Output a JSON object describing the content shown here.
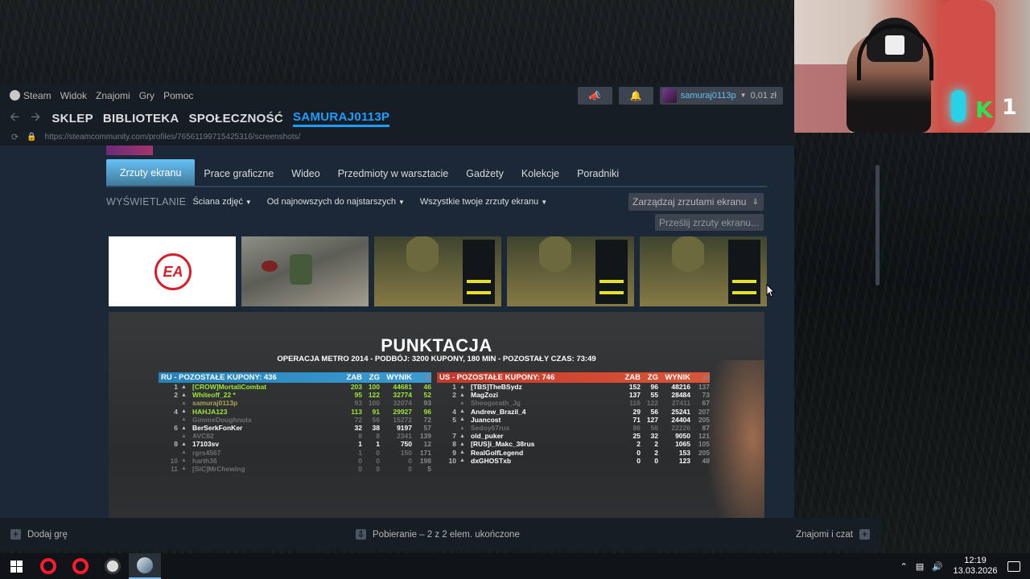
{
  "menubar": {
    "items": [
      "Steam",
      "Widok",
      "Znajomi",
      "Gry",
      "Pomoc"
    ],
    "username": "samuraj0113p",
    "balance": "0,01 zł",
    "megaphone_icon": "megaphone-icon",
    "bell_icon": "bell-icon"
  },
  "nav": {
    "links": [
      "SKLEP",
      "BIBLIOTEKA",
      "SPOŁECZNOŚĆ",
      "SAMURAJ0113P"
    ],
    "url": "https://steamcommunity.com/profiles/76561199715425316/screenshots/"
  },
  "tabs": [
    "Zrzuty ekranu",
    "Prace graficzne",
    "Wideo",
    "Przedmioty w warsztacie",
    "Gadżety",
    "Kolekcje",
    "Poradniki"
  ],
  "filters": {
    "label": "WYŚWIETLANIE",
    "view": "Ściana zdjęć",
    "sort": "Od najnowszych do najstarszych",
    "scope": "Wszystkie twoje zrzuty ekranu"
  },
  "buttons": {
    "manage": "Zarządzaj zrzutami ekranu",
    "upload": "Prześlij zrzuty ekranu..."
  },
  "thumb_ea_text": "EA",
  "scoreboard": {
    "title": "PUNKTACJA",
    "subtitle": "OPERACJA METRO 2014  -  PODBÓJ: 3200 KUPONY, 180 MIN  -  POZOSTAŁY CZAS: 73:49",
    "ghost_name": "Sheogorath_Jg",
    "cols": [
      "ZAB",
      "ZG",
      "WYNIK"
    ],
    "ru": {
      "header": "RU  -  POZOSTAŁE KUPONY: 436",
      "players": [
        {
          "r": "1",
          "n": "[CROW]MortaliCombat",
          "k": "203",
          "d": "100",
          "s": "44681",
          "p": "46",
          "cls": "green"
        },
        {
          "r": "2",
          "n": "Whiteoff_22 *",
          "k": "95",
          "d": "122",
          "s": "32774",
          "p": "52",
          "cls": "green"
        },
        {
          "r": "",
          "n": "samuraj0113p",
          "k": "93",
          "d": "100",
          "s": "32074",
          "p": "93",
          "cls": "dim self"
        },
        {
          "r": "4",
          "n": "HAHJA123",
          "k": "113",
          "d": "91",
          "s": "29927",
          "p": "96",
          "cls": "green"
        },
        {
          "r": "",
          "n": "GimmeDoughnuts",
          "k": "72",
          "d": "56",
          "s": "15272",
          "p": "72",
          "cls": "dim"
        },
        {
          "r": "6",
          "n": "BerSerkFonKer",
          "k": "32",
          "d": "38",
          "s": "9197",
          "p": "57",
          "cls": ""
        },
        {
          "r": "",
          "n": "AVC82",
          "k": "8",
          "d": "8",
          "s": "2341",
          "p": "139",
          "cls": "dim"
        },
        {
          "r": "8",
          "n": "17103sv",
          "k": "1",
          "d": "1",
          "s": "750",
          "p": "12",
          "cls": ""
        },
        {
          "r": "",
          "n": "rgrs4567",
          "k": "1",
          "d": "0",
          "s": "150",
          "p": "171",
          "cls": "dim"
        },
        {
          "r": "10",
          "n": "harth36",
          "k": "0",
          "d": "0",
          "s": "0",
          "p": "198",
          "cls": "dim"
        },
        {
          "r": "11",
          "n": "[SiC]MrChewing",
          "k": "0",
          "d": "0",
          "s": "0",
          "p": "5",
          "cls": "dim"
        }
      ]
    },
    "us": {
      "header": "US  -  POZOSTAŁE KUPONY: 746",
      "players": [
        {
          "r": "1",
          "n": "[TBS]TheBSydz",
          "k": "152",
          "d": "96",
          "s": "48216",
          "p": "137",
          "cls": ""
        },
        {
          "r": "2",
          "n": "MagZozi",
          "k": "137",
          "d": "55",
          "s": "28484",
          "p": "73",
          "cls": ""
        },
        {
          "r": "",
          "n": "Sheogorath_Jg",
          "k": "116",
          "d": "122",
          "s": "27411",
          "p": "67",
          "cls": "dim"
        },
        {
          "r": "4",
          "n": "Andrew_Brazil_4",
          "k": "29",
          "d": "56",
          "s": "25241",
          "p": "207",
          "cls": ""
        },
        {
          "r": "5",
          "n": "Juancost",
          "k": "71",
          "d": "127",
          "s": "24404",
          "p": "205",
          "cls": ""
        },
        {
          "r": "",
          "n": "Sedoy67rus",
          "k": "86",
          "d": "56",
          "s": "22226",
          "p": "87",
          "cls": "dim"
        },
        {
          "r": "7",
          "n": "old_puker",
          "k": "25",
          "d": "32",
          "s": "9050",
          "p": "121",
          "cls": ""
        },
        {
          "r": "8",
          "n": "[RUS]i_Makc_38rus",
          "k": "2",
          "d": "2",
          "s": "1065",
          "p": "105",
          "cls": ""
        },
        {
          "r": "9",
          "n": "RealGolfLegend",
          "k": "0",
          "d": "2",
          "s": "153",
          "p": "205",
          "cls": ""
        },
        {
          "r": "10",
          "n": "dxGHOSTxb",
          "k": "0",
          "d": "0",
          "s": "123",
          "p": "48",
          "cls": ""
        }
      ]
    }
  },
  "statusbar": {
    "add_game": "Dodaj grę",
    "downloads": "Pobieranie – 2 z 2 elem. ukończone",
    "friends": "Znajomi i czat"
  },
  "overlay": {
    "k_letter": "K",
    "k_count": "1"
  },
  "taskbar": {
    "time": "12:19",
    "date": "13.03.2026"
  }
}
